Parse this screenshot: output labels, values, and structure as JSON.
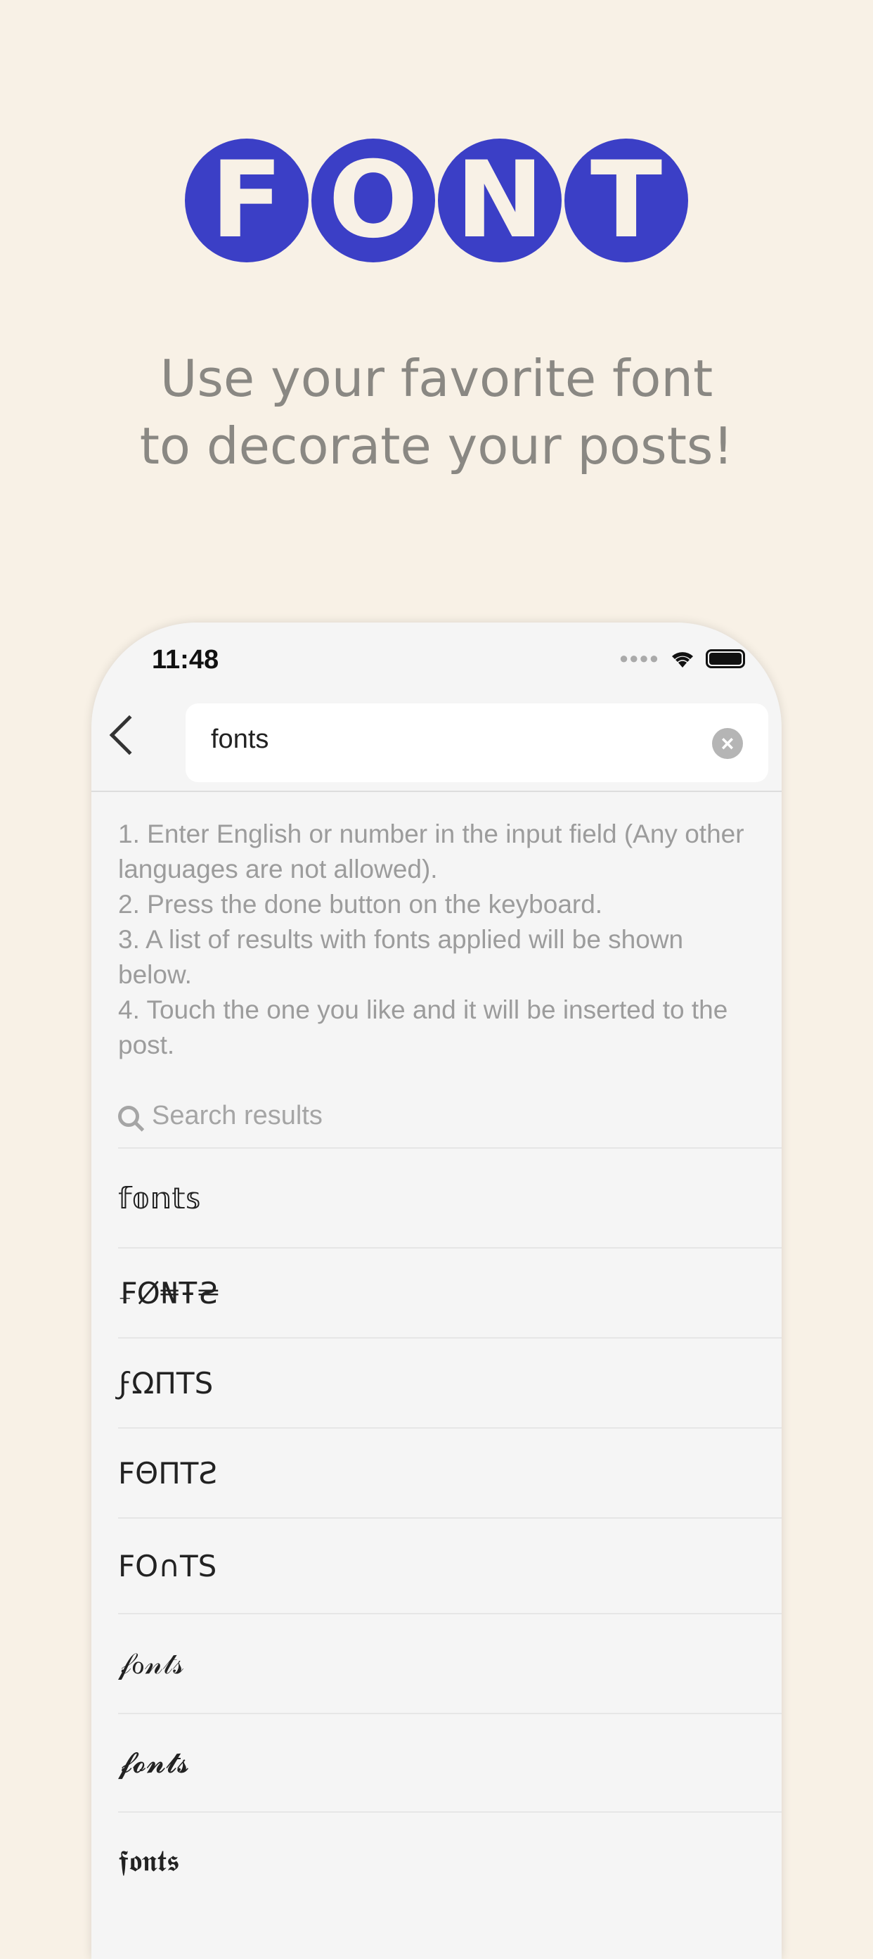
{
  "logo": {
    "letters": [
      "F",
      "O",
      "N",
      "T"
    ],
    "color": "#3b3fc6"
  },
  "tagline": {
    "line1": "Use your favorite font",
    "line2": "to decorate your posts!"
  },
  "status_bar": {
    "time": "11:48"
  },
  "search": {
    "value": "fonts"
  },
  "instructions": [
    "1. Enter English or number in the input field (Any other languages are not allowed).",
    "2. Press the done button on the keyboard.",
    "3. A list of results with fonts applied will be shown below.",
    "4. Touch the one you like and it will be inserted to the post."
  ],
  "results_label": "Search results",
  "results": [
    "𝕗𝕠𝕟𝕥𝕤",
    "₣Ø₦Ŧ₴",
    "ϝΩΠTS",
    "FΘΠTƧ",
    "FO∩TS",
    "𝒻ℴ𝓃𝓉𝓈",
    "𝓯𝓸𝓷𝓽𝓼",
    "𝖋𝖔𝖓𝖙𝖘"
  ]
}
